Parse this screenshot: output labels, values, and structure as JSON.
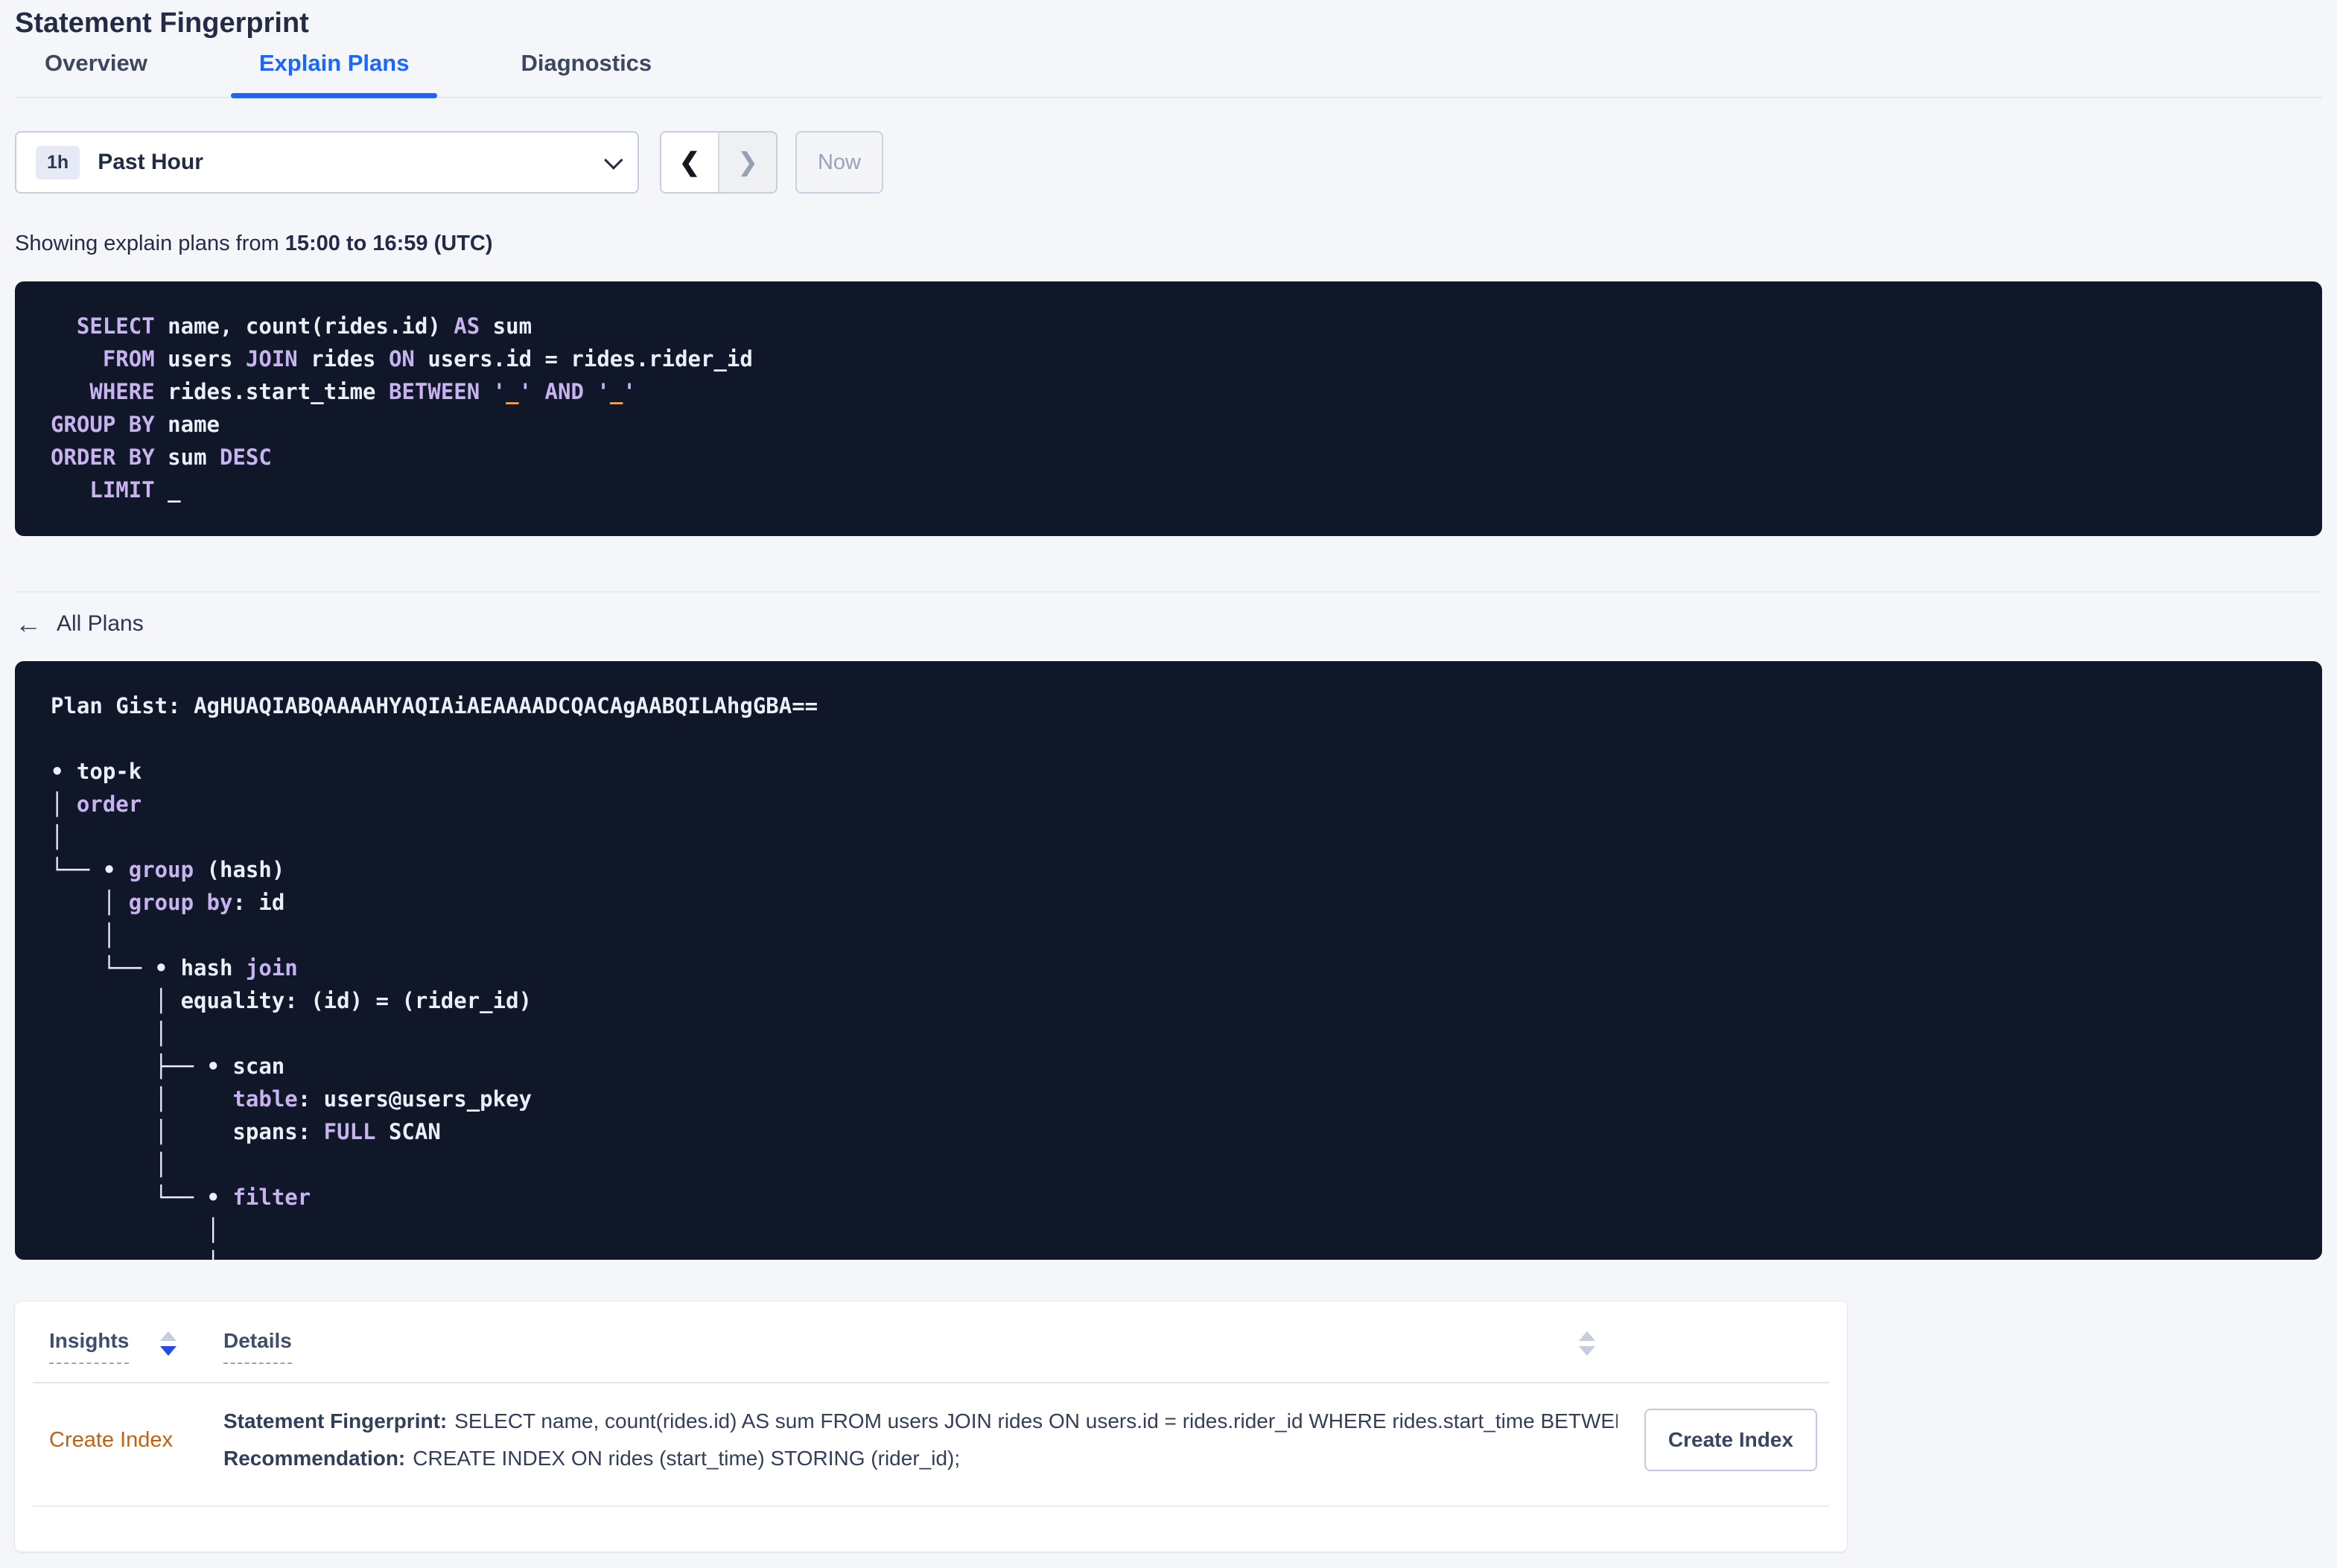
{
  "page": {
    "title": "Statement Fingerprint"
  },
  "tabs": [
    {
      "label": "Overview",
      "active": false
    },
    {
      "label": "Explain Plans",
      "active": true
    },
    {
      "label": "Diagnostics",
      "active": false
    }
  ],
  "time_selector": {
    "badge": "1h",
    "label": "Past Hour",
    "now_label": "Now"
  },
  "icons": {
    "chevron_left": "❮",
    "chevron_right": "❯",
    "back_arrow": "←"
  },
  "showing": {
    "prefix": "Showing explain plans from ",
    "range": "15:00 to 16:59 (UTC)"
  },
  "sql": {
    "lines": [
      [
        [
          "pl",
          "  "
        ],
        [
          "kw",
          "SELECT"
        ],
        [
          "pl",
          " name, count(rides.id) "
        ],
        [
          "kw",
          "AS"
        ],
        [
          "pl",
          " sum"
        ]
      ],
      [
        [
          "pl",
          "    "
        ],
        [
          "kw",
          "FROM"
        ],
        [
          "pl",
          " users "
        ],
        [
          "kw",
          "JOIN"
        ],
        [
          "pl",
          " rides "
        ],
        [
          "kw",
          "ON"
        ],
        [
          "pl",
          " users.id = rides.rider_id"
        ]
      ],
      [
        [
          "pl",
          "   "
        ],
        [
          "kw",
          "WHERE"
        ],
        [
          "pl",
          " rides.start_time "
        ],
        [
          "kw",
          "BETWEEN"
        ],
        [
          "pl",
          " "
        ],
        [
          "kw",
          "'"
        ],
        [
          "lit",
          "_"
        ],
        [
          "kw",
          "'"
        ],
        [
          "pl",
          " "
        ],
        [
          "kw",
          "AND"
        ],
        [
          "pl",
          " "
        ],
        [
          "kw",
          "'"
        ],
        [
          "lit",
          "_"
        ],
        [
          "kw",
          "'"
        ]
      ],
      [
        [
          "kw",
          "GROUP BY"
        ],
        [
          "pl",
          " name"
        ]
      ],
      [
        [
          "kw",
          "ORDER BY"
        ],
        [
          "pl",
          " sum "
        ],
        [
          "kw",
          "DESC"
        ]
      ],
      [
        [
          "pl",
          "   "
        ],
        [
          "kw",
          "LIMIT"
        ],
        [
          "pl",
          " _"
        ]
      ]
    ]
  },
  "all_plans_label": "All Plans",
  "plan": {
    "gist_label": "Plan Gist: ",
    "gist": "AgHUAQIABQAAAAHYAQIAiAEAAAADCQACAgAABQILAhgGBA==",
    "tree_lines": [
      [
        [
          "pl",
          "• top-k"
        ]
      ],
      [
        [
          "pl",
          "│ "
        ],
        [
          "kw",
          "order"
        ]
      ],
      [
        [
          "pl",
          "│"
        ]
      ],
      [
        [
          "pl",
          "└── • "
        ],
        [
          "kw",
          "group"
        ],
        [
          "pl",
          " (hash)"
        ]
      ],
      [
        [
          "pl",
          "    │ "
        ],
        [
          "kw",
          "group by"
        ],
        [
          "pl",
          ": id"
        ]
      ],
      [
        [
          "pl",
          "    │"
        ]
      ],
      [
        [
          "pl",
          "    └── • hash "
        ],
        [
          "kw",
          "join"
        ]
      ],
      [
        [
          "pl",
          "        │ equality: (id) = (rider_id)"
        ]
      ],
      [
        [
          "pl",
          "        │"
        ]
      ],
      [
        [
          "pl",
          "        ├── • scan"
        ]
      ],
      [
        [
          "pl",
          "        │     "
        ],
        [
          "kw",
          "table"
        ],
        [
          "pl",
          ": users@users_pkey"
        ]
      ],
      [
        [
          "pl",
          "        │     spans: "
        ],
        [
          "kw",
          "FULL"
        ],
        [
          "pl",
          " SCAN"
        ]
      ],
      [
        [
          "pl",
          "        │"
        ]
      ],
      [
        [
          "pl",
          "        └── • "
        ],
        [
          "kw",
          "filter"
        ]
      ],
      [
        [
          "pl",
          "            │"
        ]
      ],
      [
        [
          "pl",
          "            │"
        ]
      ]
    ]
  },
  "insights_table": {
    "columns": [
      "Insights",
      "Details"
    ],
    "rows": [
      {
        "insight": "Create Index",
        "fingerprint_label": "Statement Fingerprint:",
        "fingerprint": "SELECT name, count(rides.id) AS sum FROM users JOIN rides ON users.id = rides.rider_id WHERE rides.start_time BETWEEN '_…",
        "recommendation_label": "Recommendation:",
        "recommendation": "CREATE INDEX ON rides (start_time) STORING (rider_id);",
        "action": "Create Index"
      }
    ]
  },
  "colors": {
    "page_bg": "#f4f6fa",
    "panel_bg": "#0f1729",
    "code_text": "#eceff7",
    "keyword": "#c8b3f0",
    "literal": "#ffa53e",
    "heading": "#242c45",
    "tab_active": "#1a66ff",
    "link_insight": "#c2620f",
    "sort_active": "#2749e8",
    "sort_inactive": "#c5cddf"
  }
}
